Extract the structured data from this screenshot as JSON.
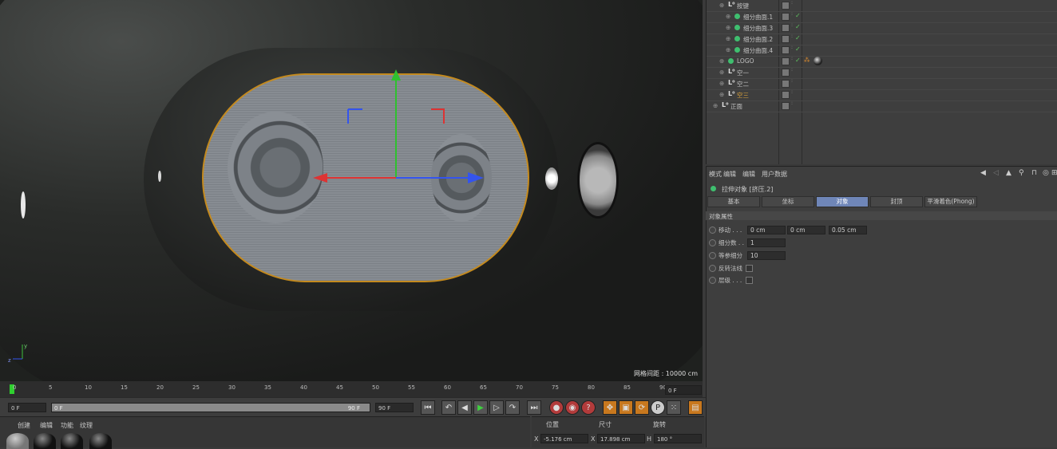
{
  "viewport": {
    "grid_spacing": "网格间距 : 10000 cm"
  },
  "objects": {
    "items": [
      {
        "name": "按键",
        "kind": "null"
      },
      {
        "name": "细分曲面.1",
        "kind": "sub"
      },
      {
        "name": "细分曲面.3",
        "kind": "sub"
      },
      {
        "name": "细分曲面.2",
        "kind": "sub"
      },
      {
        "name": "细分曲面.4",
        "kind": "sub"
      },
      {
        "name": "LOGO",
        "kind": "obj"
      },
      {
        "name": "空一",
        "kind": "null"
      },
      {
        "name": "空二",
        "kind": "null"
      },
      {
        "name": "空三",
        "kind": "null"
      },
      {
        "name": "正面",
        "kind": "null"
      }
    ]
  },
  "attributes": {
    "menu": {
      "mode": "模式",
      "edit": "编辑",
      "userdata": "用户数据"
    },
    "object_title": "拉伸对象 [挤压.2]",
    "tabs": [
      "基本",
      "坐标",
      "对象",
      "封顶",
      "平滑着色(Phong)"
    ],
    "section": "对象属性",
    "props": {
      "move_label": "移动 . . .",
      "move_x": "0 cm",
      "move_y": "0 cm",
      "move_z": "0.05 cm",
      "subdiv_label": "细分数 . .",
      "subdiv": "1",
      "iso_label": "等参细分",
      "iso": "10",
      "flip_label": "反转法线",
      "hier_label": "层级 . . ."
    }
  },
  "timeline": {
    "ticks": [
      "0",
      "5",
      "10",
      "15",
      "20",
      "25",
      "30",
      "35",
      "40",
      "45",
      "50",
      "55",
      "60",
      "65",
      "70",
      "75",
      "80",
      "85",
      "90"
    ],
    "current_frame": "0 F",
    "start_field": "0 F",
    "slider_start": "0 F",
    "slider_end": "90 F",
    "end_field": "90 F"
  },
  "material": {
    "menu": [
      "创建",
      "编辑",
      "功能",
      "纹理"
    ]
  },
  "coords": {
    "headers": [
      "位置",
      "尺寸",
      "旋转"
    ],
    "x_label": "X",
    "x_pos": "-5.176 cm",
    "x2_label": "X",
    "x_size": "17.898 cm",
    "h_label": "H",
    "h_rot": "180 °"
  },
  "colors": {
    "selection": "#c48a1e",
    "tab_active": "#6f86b8",
    "check": "#5fc15f"
  }
}
